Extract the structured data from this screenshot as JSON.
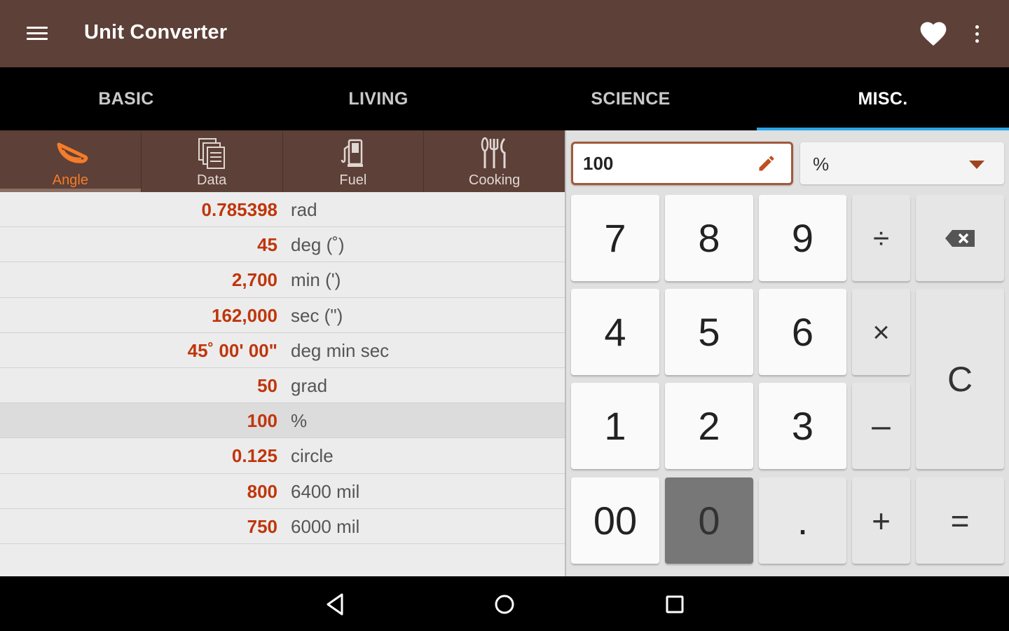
{
  "app": {
    "title": "Unit Converter"
  },
  "tabs": [
    {
      "label": "BASIC",
      "active": false
    },
    {
      "label": "LIVING",
      "active": false
    },
    {
      "label": "SCIENCE",
      "active": false
    },
    {
      "label": "MISC.",
      "active": true
    }
  ],
  "categories": [
    {
      "label": "Angle",
      "icon": "angle-icon",
      "active": true
    },
    {
      "label": "Data",
      "icon": "data-icon",
      "active": false
    },
    {
      "label": "Fuel",
      "icon": "fuel-icon",
      "active": false
    },
    {
      "label": "Cooking",
      "icon": "cooking-icon",
      "active": false
    }
  ],
  "results": [
    {
      "value": "0.785398",
      "unit": "rad"
    },
    {
      "value": "45",
      "unit": "deg (˚)"
    },
    {
      "value": "2,700",
      "unit": "min (')"
    },
    {
      "value": "162,000",
      "unit": "sec (\")"
    },
    {
      "value": "45˚ 00' 00\"",
      "unit": "deg min sec"
    },
    {
      "value": "50",
      "unit": "grad"
    },
    {
      "value": "100",
      "unit": "%",
      "selected": true
    },
    {
      "value": "0.125",
      "unit": "circle"
    },
    {
      "value": "800",
      "unit": "6400 mil"
    },
    {
      "value": "750",
      "unit": "6000 mil"
    }
  ],
  "input": {
    "value": "100",
    "unit": "%"
  },
  "keypad": {
    "k7": "7",
    "k8": "8",
    "k9": "9",
    "div": "÷",
    "k4": "4",
    "k5": "5",
    "k6": "6",
    "mul": "×",
    "k1": "1",
    "k2": "2",
    "k3": "3",
    "minus": "–",
    "k00": "00",
    "k0": "0",
    "dot": ".",
    "plus": "+",
    "clear": "C",
    "equals": "="
  },
  "colors": {
    "appbar": "#5d4037",
    "accent": "#f57c2a",
    "value_text": "#bf360c",
    "tab_indicator": "#2aa6e8"
  }
}
